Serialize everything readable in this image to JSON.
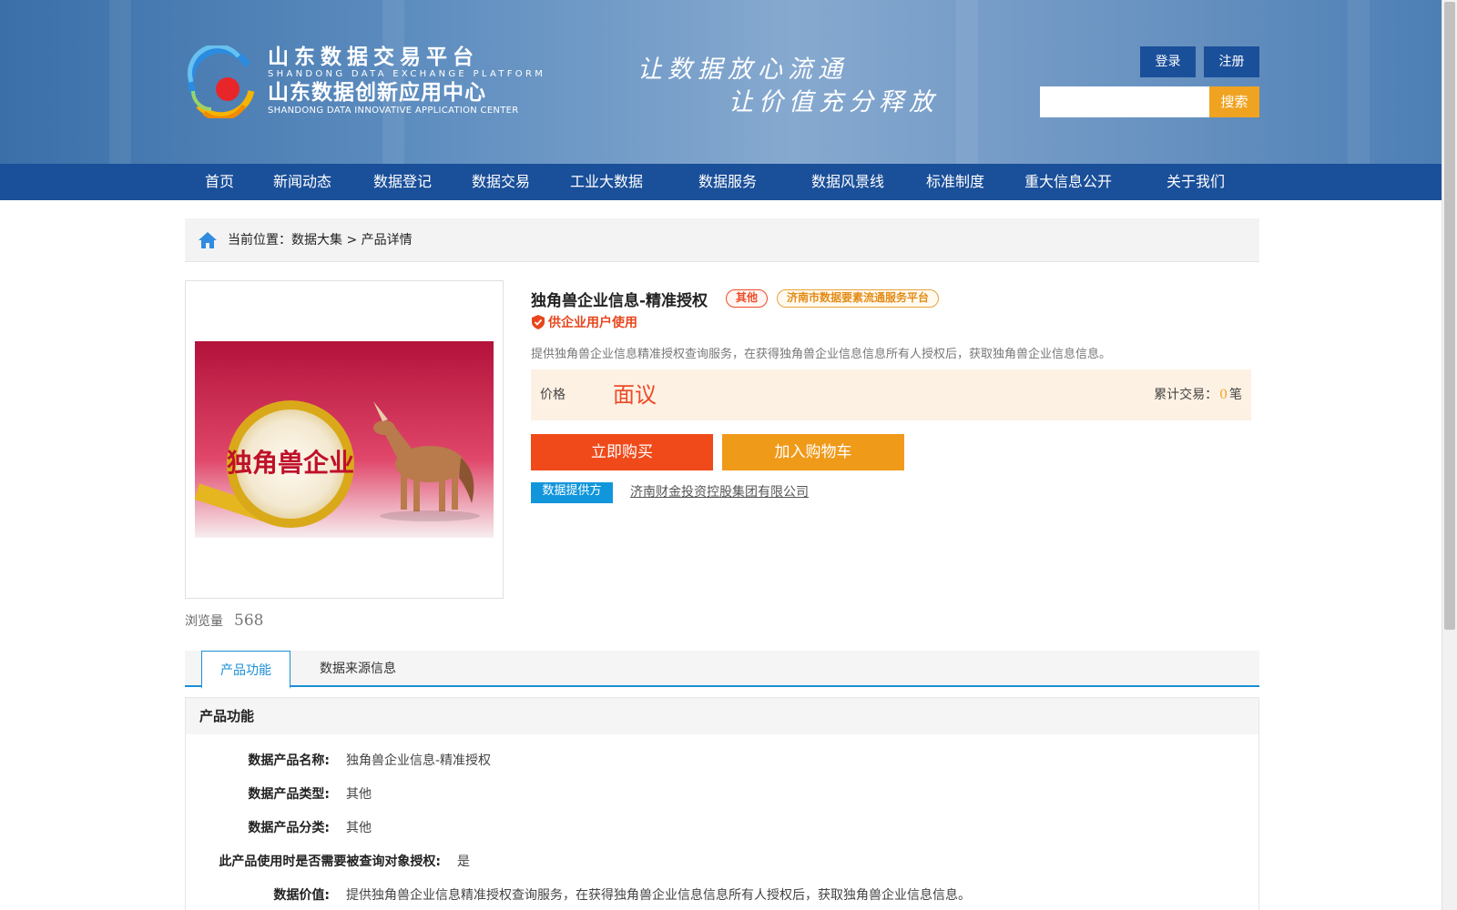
{
  "header": {
    "brand_cn_1": "山东数据交易平台",
    "brand_en_1": "SHANDONG DATA EXCHANGE PLATFORM",
    "brand_cn_2": "山东数据创新应用中心",
    "brand_en_2": "SHANDONG DATA INNOVATIVE APPLICATION CENTER",
    "slogan_1": "让数据放心流通",
    "slogan_2": "让价值充分释放",
    "login_label": "登录",
    "register_label": "注册",
    "search_placeholder": "",
    "search_label": "搜索"
  },
  "nav": {
    "items": [
      "首页",
      "新闻动态",
      "数据登记",
      "数据交易",
      "工业大数据",
      "数据服务",
      "数据风景线",
      "标准制度",
      "重大信息公开",
      "关于我们"
    ]
  },
  "breadcrumb": {
    "text": "当前位置：数据大集 > 产品详情"
  },
  "product": {
    "image_text": "独角兽企业",
    "views_label": "浏览量",
    "views_count": "568",
    "title": "独角兽企业信息-精准授权",
    "tag_type": "其他",
    "tag_platform": "济南市数据要素流通服务平台",
    "audience": "供企业用户使用",
    "description": "提供独角兽企业信息精准授权查询服务，在获得独角兽企业信息信息所有人授权后，获取独角兽企业信息信息。",
    "price_label": "价格",
    "price_value": "面议",
    "trade_label": "累计交易：",
    "trade_count": "0",
    "trade_unit": "笔",
    "buy_label": "立即购买",
    "cart_label": "加入购物车",
    "provider_label": "数据提供方",
    "provider_name": "济南财金投资控股集团有限公司"
  },
  "tabs": [
    "产品功能",
    "数据来源信息"
  ],
  "details": {
    "section_title": "产品功能",
    "rows": [
      {
        "key": "数据产品名称:",
        "value": "独角兽企业信息-精准授权"
      },
      {
        "key": "数据产品类型:",
        "value": "其他"
      },
      {
        "key": "数据产品分类:",
        "value": "其他"
      },
      {
        "key": "此产品使用时是否需要被查询对象授权:",
        "value": "是"
      },
      {
        "key": "数据价值:",
        "value": "提供独角兽企业信息精准授权查询服务，在获得独角兽企业信息信息所有人授权后，获取独角兽企业信息信息。"
      }
    ]
  },
  "colors": {
    "nav_blue": "#1a4f99",
    "accent_orange": "#f0a321",
    "buy_red": "#f04a1a",
    "link_blue": "#1a8fd6"
  }
}
